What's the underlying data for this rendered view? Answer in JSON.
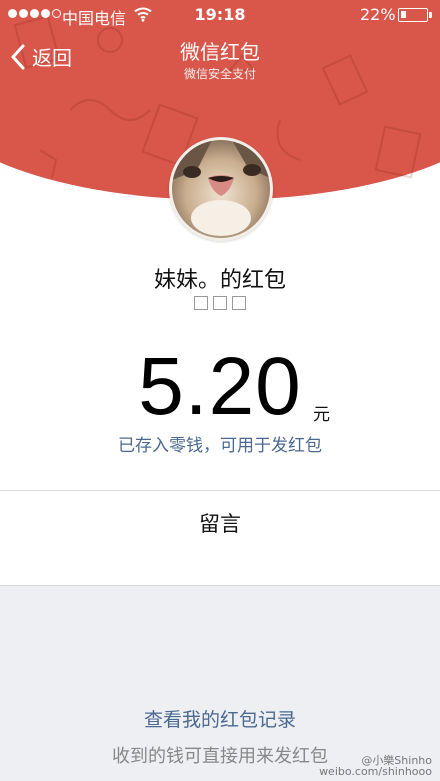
{
  "status_bar": {
    "carrier": "中国电信",
    "time": "19:18",
    "battery_percent": "22%",
    "battery_level": 0.22,
    "signal_bars_filled": 4,
    "signal_bars_total": 5
  },
  "nav": {
    "back_label": "返回",
    "title": "微信红包",
    "subtitle": "微信安全支付"
  },
  "packet": {
    "sender_title": "妹妹。的红包",
    "amount": "5.20",
    "currency": "元",
    "deposit_note": "已存入零钱，可用于发红包"
  },
  "message_label": "留言",
  "footer": {
    "records_link": "查看我的红包记录",
    "note": "收到的钱可直接用来发红包"
  },
  "watermark": {
    "line1": "@小樂Shinho",
    "line2": "weibo.com/shinhooo"
  },
  "colors": {
    "header_red": "#d8564a",
    "link_blue": "#4b6891",
    "gray_bg": "#eeeff2"
  },
  "icons": {
    "back": "chevron-left-icon",
    "wifi": "wifi-icon",
    "battery": "battery-icon"
  }
}
